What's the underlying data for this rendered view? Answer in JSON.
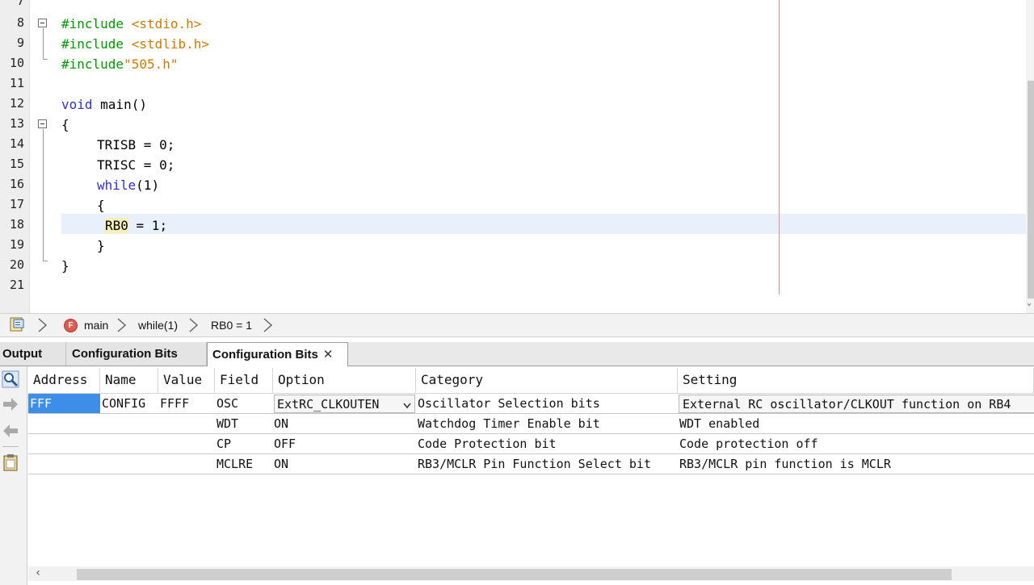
{
  "editor": {
    "lines": [
      {
        "num": "7",
        "code": ""
      },
      {
        "num": "8",
        "directive": "#include",
        "arg": " <stdio.h>"
      },
      {
        "num": "9",
        "directive": "#include",
        "arg": " <stdlib.h>"
      },
      {
        "num": "10",
        "directive": "#include",
        "arg": "\"505.h\""
      },
      {
        "num": "11",
        "code": ""
      },
      {
        "num": "12",
        "kw": "void",
        "rest": " main()"
      },
      {
        "num": "13",
        "code": "{"
      },
      {
        "num": "14",
        "code": "TRISB = 0;"
      },
      {
        "num": "15",
        "code": "TRISC = 0;"
      },
      {
        "num": "16",
        "kw": "while",
        "rest": "(1)"
      },
      {
        "num": "17",
        "code": "{"
      },
      {
        "num": "18",
        "highlight": "RB0",
        "rest": " = 1;"
      },
      {
        "num": "19",
        "code": "}"
      },
      {
        "num": "20",
        "code": "}"
      },
      {
        "num": "21",
        "code": ""
      }
    ]
  },
  "breadcrumb": {
    "items": [
      "main",
      "while(1)",
      "RB0 = 1"
    ],
    "func_icon_letter": "F"
  },
  "tabs": [
    {
      "label": "Output"
    },
    {
      "label": "Configuration Bits"
    },
    {
      "label": "Configuration Bits",
      "close": "✕"
    }
  ],
  "config_table": {
    "columns": [
      "Address",
      "Name",
      "Value",
      "Field",
      "Option",
      "Category",
      "Setting"
    ],
    "rows": [
      {
        "address": "FFF",
        "name": "CONFIG",
        "value": "FFFF",
        "field": "OSC",
        "option": "ExtRC_CLKOUTEN",
        "category": "Oscillator Selection bits",
        "setting": "External RC oscillator/CLKOUT function on RB4"
      },
      {
        "address": "",
        "name": "",
        "value": "",
        "field": "WDT",
        "option": "ON",
        "category": "Watchdog Timer Enable bit",
        "setting": "WDT enabled"
      },
      {
        "address": "",
        "name": "",
        "value": "",
        "field": "CP",
        "option": "OFF",
        "category": "Code Protection bit",
        "setting": "Code protection off"
      },
      {
        "address": "",
        "name": "",
        "value": "",
        "field": "MCLRE",
        "option": "ON",
        "category": "RB3/MCLR Pin Function Select bit",
        "setting": "RB3/MCLR pin function is MCLR"
      }
    ]
  },
  "icons": {
    "breadcrumb_file": "source-file-icon",
    "breadcrumb_function": "function-icon",
    "tool_search": "magnifier-icon",
    "tool_read": "arrow-right-icon",
    "tool_write": "arrow-left-icon",
    "tool_generate": "clipboard-icon"
  },
  "colors": {
    "preprocessor": "#009900",
    "string": "#ce7b00",
    "keyword": "#2f2fcf",
    "selection": "#3d8ee8",
    "current_line": "#e8f0fb"
  }
}
